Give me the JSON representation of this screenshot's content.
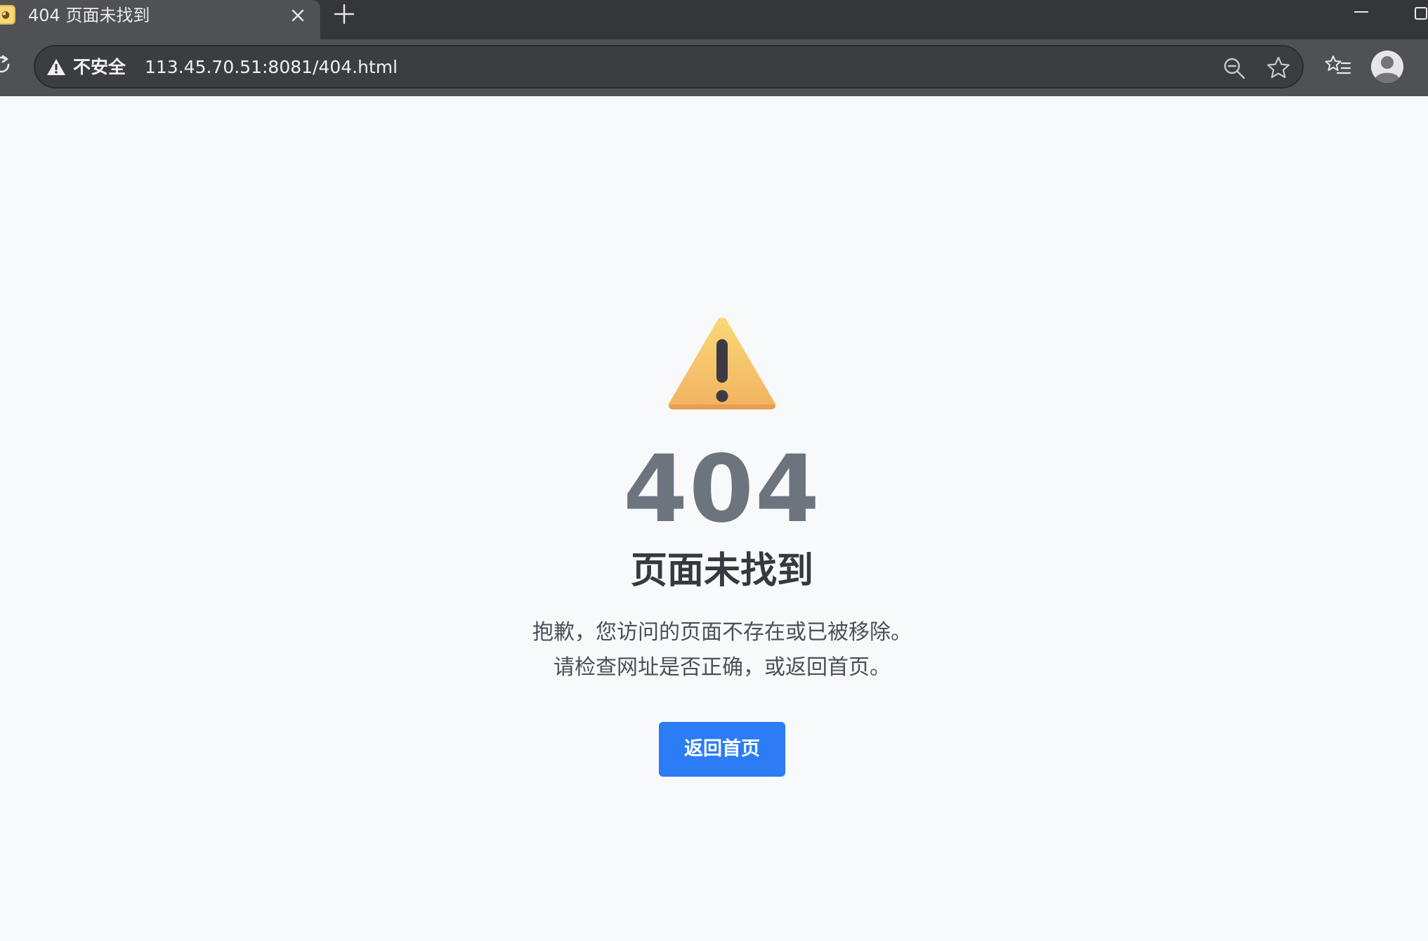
{
  "browser": {
    "tab": {
      "favicon": "cat-face-icon",
      "title": "404 页面未找到"
    },
    "icons": {
      "close": "close-icon",
      "new_tab": "plus-icon",
      "minimize": "minimize-icon",
      "maximize": "maximize-icon",
      "reload": "reload-icon",
      "security": "warning-triangle-icon",
      "zoom": "zoom-out-icon",
      "bookmark": "star-icon",
      "favorites": "favorites-icon",
      "profile": "avatar-icon"
    },
    "address_bar": {
      "security_label": "不安全",
      "url": "113.45.70.51:8081/404.html"
    }
  },
  "page": {
    "icon": "warning-emoji",
    "error_code": "404",
    "title": "页面未找到",
    "message_line1": "抱歉，您访问的页面不存在或已被移除。",
    "message_line2": "请检查网址是否正确，或返回首页。",
    "home_button_label": "返回首页"
  },
  "colors": {
    "tabstrip": "#35363a",
    "toolbar": "#505155",
    "page_background": "#f8f9fa",
    "error_code": "#6c757d",
    "title": "#343a40",
    "message": "#495057",
    "button": "#2b7cf5",
    "warning_yellow": "#f6c86a"
  }
}
